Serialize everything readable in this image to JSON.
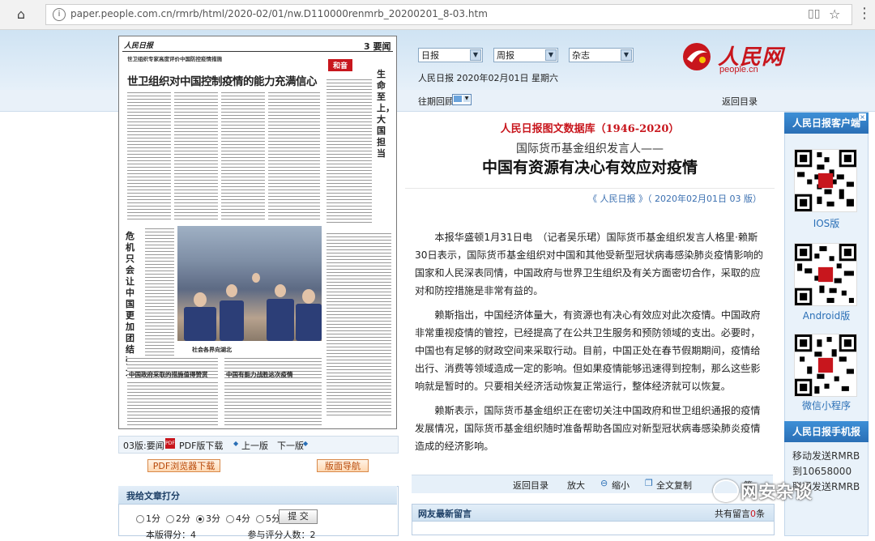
{
  "browser": {
    "url": "paper.people.com.cn/rmrb/html/2020-02/01/nw.D110000renmrb_20200201_8-03.htm"
  },
  "header": {
    "selects": [
      "日报",
      "周报",
      "杂志"
    ],
    "date_line": "人民日报 2020年02月01日 星期六",
    "logo_text": "人民网",
    "logo_url": "people.cn",
    "past_issues_label": "往期回顾",
    "back_to_index": "返回目录"
  },
  "paper": {
    "masthead": "人民日报",
    "page_tag": "3 要闻",
    "badge": "和音",
    "top_intro": "世卫组织专家高度评价中国防控疫情措施",
    "lead_headline": "世卫组织对中国控制疫情的能力充满信心",
    "vertical_headline_1": "生命至上，大国担当",
    "vertical_headline_2": "危机只会让中国更加团结强大",
    "photo_caption": "社会各界向湖北",
    "bottom_headline_1": "中国政府采取的措施值得赞赏",
    "bottom_headline_2": "中国有能力战胜这次疫情"
  },
  "paper_footer": {
    "page_label": "03版:要闻",
    "pdf_download": "PDF版下载",
    "prev_page": "上一版",
    "next_page": "下一版",
    "pdf_browser_download": "PDF浏览器下载",
    "page_nav": "版面导航"
  },
  "rating": {
    "title": "我给文章打分",
    "options": [
      "1分",
      "2分",
      "3分",
      "4分",
      "5分"
    ],
    "selected_index": 2,
    "submit": "提 交",
    "avg_label": "本版得分：",
    "avg_value": "4",
    "voters_label": "参与评分人数：",
    "voters_value": "2"
  },
  "article": {
    "database_title": "人民日报图文数据库（1946-2020）",
    "kicker": "国际货币基金组织发言人——",
    "headline": "中国有资源有决心有效应对疫情",
    "source": "《 人民日报 》（ 2020年02月01日   03 版）",
    "paragraphs": [
      "本报华盛顿1月31日电　（记者吴乐珺）国际货币基金组织发言人格里·赖斯30日表示，国际货币基金组织对中国和其他受新型冠状病毒感染肺炎疫情影响的国家和人民深表同情，中国政府与世界卫生组织及有关方面密切合作，采取的应对和防控措施是非常有益的。",
      "赖斯指出，中国经济体量大，有资源也有决心有效应对此次疫情。中国政府非常重视疫情的管控，已经提高了在公共卫生服务和预防领域的支出。必要时，中国也有足够的财政空间来采取行动。目前，中国正处在春节假期期间，疫情给出行、消费等领域造成一定的影响。但如果疫情能够迅速得到控制，那么这些影响就是暂时的。只要相关经济活动恢复正常运行，整体经济就可以恢复。",
      "赖斯表示，国际货币基金组织正在密切关注中国政府和世卫组织通报的疫情发展情况，国际货币基金组织随时准备帮助各国应对新型冠状病毒感染肺炎疫情造成的经济影响。"
    ],
    "tools": [
      "返回目录",
      "放大",
      "缩小",
      "全文复制",
      "篇"
    ],
    "comments_title": "网友最新留言",
    "comments_count_label": "共有留言",
    "comments_count": "0",
    "comments_unit": "条"
  },
  "sidebar": {
    "client_title": "人民日报客户端",
    "qr_labels": [
      "IOS版",
      "Android版",
      "微信小程序"
    ],
    "mobile_title": "人民日报手机报",
    "mobile_lines": [
      "移动发送RMRB",
      "到10658000",
      "联通发送RMRB"
    ]
  },
  "watermark": "网安杂谈"
}
